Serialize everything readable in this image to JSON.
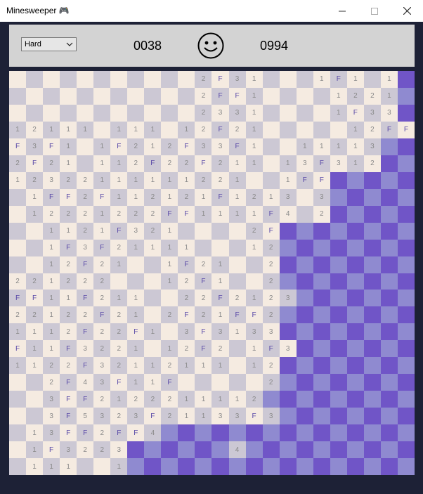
{
  "window": {
    "title": "Minesweeper 🎮",
    "minimize": "—",
    "maximize": "☐",
    "close": "✕"
  },
  "toolbar": {
    "difficulty": "Hard",
    "mine_counter": "0038",
    "timer": "0994",
    "face": "smiley-face-icon"
  },
  "board": {
    "cols": 24,
    "rows": 24,
    "legend": {
      ".": "revealed empty",
      "1-8": "revealed number",
      "F": "flag",
      "u": "unrevealed"
    },
    "grid": [
      "...........2F31...1F1.1u",
      "...........2FF1....1221u",
      "...........2331....1F33u",
      "12111.111.12F21.....12FF",
      "F3F1.1F212F33F1..11113uu",
      "2F21.112F22F211.13F312uu",
      "12322111111221..1FFuuuuu",
      ".1FF2F112121F1213.3uuuuu",
      ".12221222FF1111F4.2uuuuu",
      "..1121F321....2Fuuuuuuuu",
      "..1F3F21111...12uuuuuuuu",
      "..12F21..1F21..2uuuuuuuu",
      "221222...12F1..2uuuuuuuu",
      "FF11F211..22F2123uuuuuuu",
      "22122F21.2F21FF2uuuuuuuu",
      "1112F22F1.3F3133uuuuuuuu",
      "F11F3221.12F2.1F3uuuuuuu",
      "1122F32112111.12uuuuuuuu",
      "..2F43F11F.....2uuuuuuuu",
      "..3FF2122211112uuuuuuuuu",
      "..3F5323F21133F3uuuuuuuu",
      ".13FF2FF4uuuuuuuuuuuuuuu",
      ".1F3223uuuuuu4uuuuuuuuuu",
      ".111..1uuuuuuuuuuuuuuuuu"
    ]
  },
  "colors": {
    "revealed_light": "#f5ebe1",
    "revealed_dark": "#ccc8d4",
    "unrevealed_light": "#8f8ad0",
    "unrevealed_dark": "#7055c7",
    "toolbar": "#d3d3d3",
    "background": "#1d2136"
  }
}
